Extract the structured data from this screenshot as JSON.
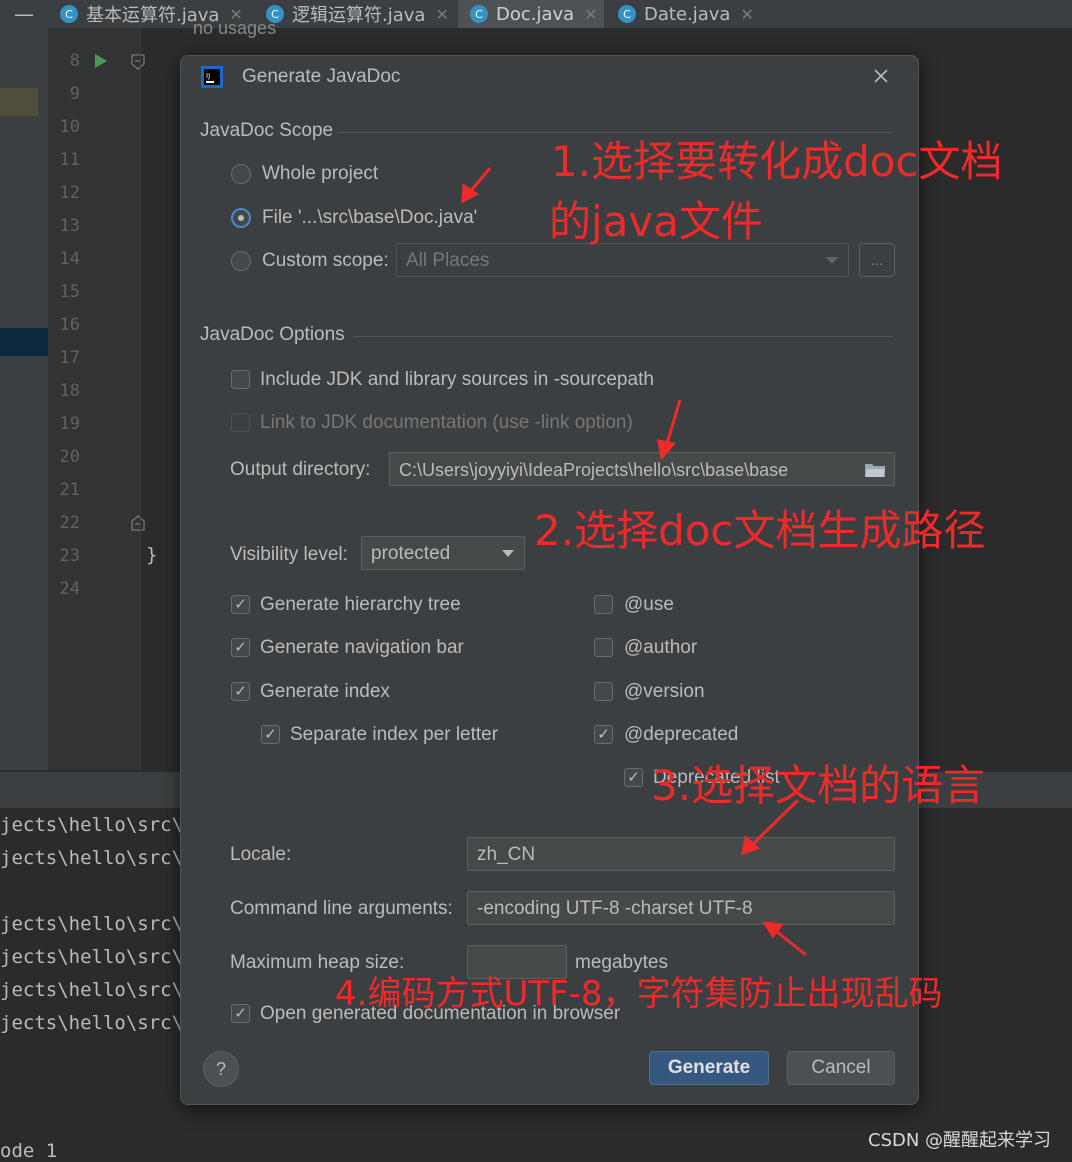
{
  "tabs": [
    {
      "label": "基本运算符.java"
    },
    {
      "label": "逻辑运算符.java"
    },
    {
      "label": "Doc.java"
    },
    {
      "label": "Date.java"
    }
  ],
  "editor": {
    "line_numbers": [
      "8",
      "9",
      "10",
      "11",
      "12",
      "13",
      "14",
      "15",
      "16",
      "17",
      "18",
      "19",
      "20",
      "21",
      "22",
      "23",
      "24"
    ],
    "hint": "no usages",
    "brace": "}"
  },
  "console": {
    "lines": [
      "jects\\hello\\src\\",
      "jects\\hello\\src\\",
      "jects\\hello\\src\\",
      "jects\\hello\\src\\",
      "jects\\hello\\src\\",
      "jects\\hello\\src\\"
    ],
    "bottom": "ode 1"
  },
  "dialog": {
    "title": "Generate JavaDoc",
    "scope": {
      "header": "JavaDoc Scope",
      "whole_project": "Whole project",
      "file": "File '...\\src\\base\\Doc.java'",
      "custom_scope": "Custom scope:",
      "custom_value": "All Places",
      "browse": "..."
    },
    "options": {
      "header": "JavaDoc Options",
      "include_jdk": "Include JDK and library sources in -sourcepath",
      "link_jdk": "Link to JDK documentation (use -link option)",
      "output_label": "Output directory:",
      "output_value": "C:\\Users\\joyyiyi\\IdeaProjects\\hello\\src\\base\\base",
      "visibility_label": "Visibility level:",
      "visibility_value": "protected",
      "hierarchy": "Generate hierarchy tree",
      "navbar": "Generate navigation bar",
      "index": "Generate index",
      "separate_index": "Separate index per letter",
      "use": "@use",
      "author": "@author",
      "version": "@version",
      "deprecated": "@deprecated",
      "deprecated_list": "Deprecated list",
      "locale_label": "Locale:",
      "locale_value": "zh_CN",
      "cmd_label": "Command line arguments:",
      "cmd_value": "-encoding UTF-8 -charset UTF-8",
      "heap_label": "Maximum heap size:",
      "heap_value": "",
      "heap_unit": "megabytes",
      "open_browser": "Open generated documentation in browser"
    },
    "help": "?",
    "generate": "Generate",
    "cancel": "Cancel"
  },
  "annotations": {
    "a1_line1": "1.选择要转化成doc文档",
    "a1_line2": "的java文件",
    "a2": "2.选择doc文档生成路径",
    "a3": "3.选择文档的语言",
    "a4": "4.编码方式UTF-8，字符集防止出现乱码"
  },
  "watermark": "CSDN @醒醒起来学习",
  "colors": {
    "accent": "#365880",
    "annotation": "#ee2a2a",
    "background": "#3c3f41"
  },
  "icons": [
    "java-class-icon",
    "close-icon",
    "run-icon",
    "fold-icon",
    "dropdown-arrow-icon",
    "folder-icon",
    "help-icon",
    "intellij-logo-icon"
  ]
}
